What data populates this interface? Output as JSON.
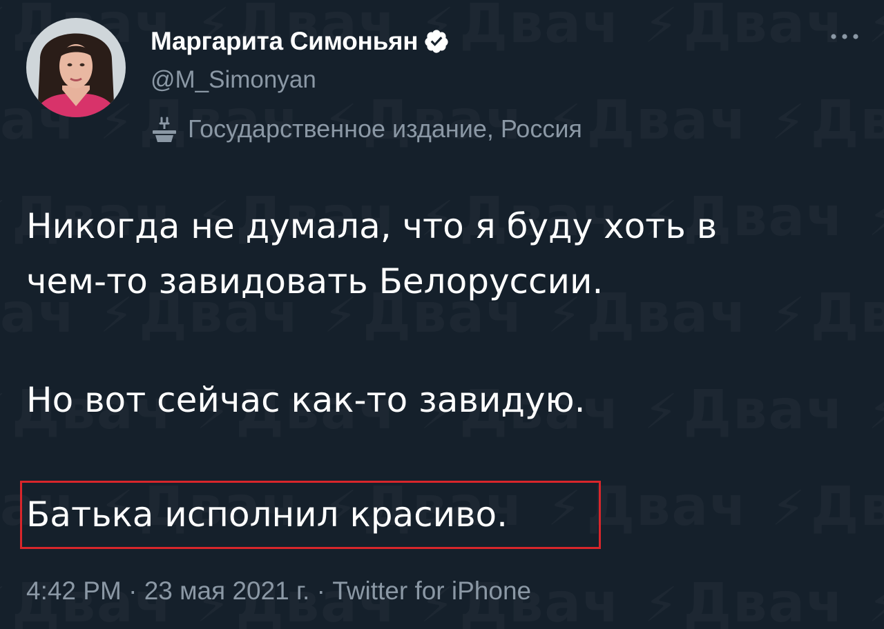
{
  "watermark": {
    "text": "Двач"
  },
  "author": {
    "name": "Маргарита Симоньян",
    "handle": "@M_Simonyan",
    "verified": true,
    "affiliation": "Государственное издание, Россия"
  },
  "tweet": {
    "lines": [
      "Никогда не думала, что я буду хоть в",
      "чем-то завидовать Белоруссии.",
      "Но вот сейчас как-то завидую.",
      "Батька исполнил красиво."
    ],
    "highlighted_line": "Батька исполнил красиво."
  },
  "meta": {
    "time": "4:42 PM",
    "date": "23 мая 2021 г.",
    "source": "Twitter for iPhone",
    "separator": "·"
  },
  "colors": {
    "background": "#15202b",
    "text": "#ffffff",
    "secondary": "#8b98a5",
    "verified_badge": "#ffffff",
    "highlight_border": "#d9262b"
  }
}
